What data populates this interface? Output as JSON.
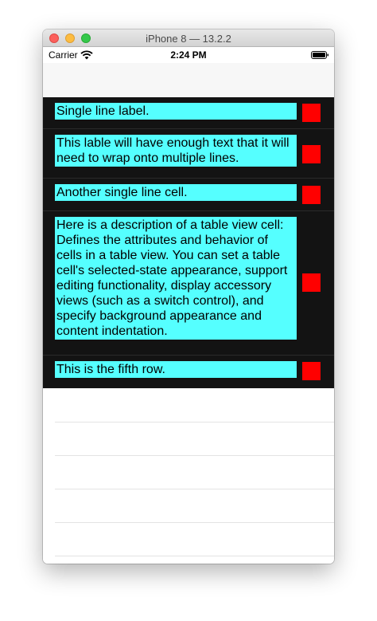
{
  "window": {
    "title": "iPhone 8 — 13.2.2"
  },
  "status_bar": {
    "carrier": "Carrier",
    "time": "2:24 PM"
  },
  "table": {
    "rows": [
      {
        "text": "Single line label."
      },
      {
        "text": "This lable will have enough text that it will need to wrap onto multiple lines."
      },
      {
        "text": "Another single line cell."
      },
      {
        "text": "Here is a description of a table view cell: Defines the attributes and behavior of cells in a table view. You can set a table cell's selected-state appearance, support editing functionality, display accessory views (such as a switch control), and specify background appearance and content indentation."
      },
      {
        "text": "This is the fifth row."
      }
    ],
    "colors": {
      "background": "#131313",
      "label_background": "#55ffff",
      "accessory": "#ff0000"
    }
  }
}
